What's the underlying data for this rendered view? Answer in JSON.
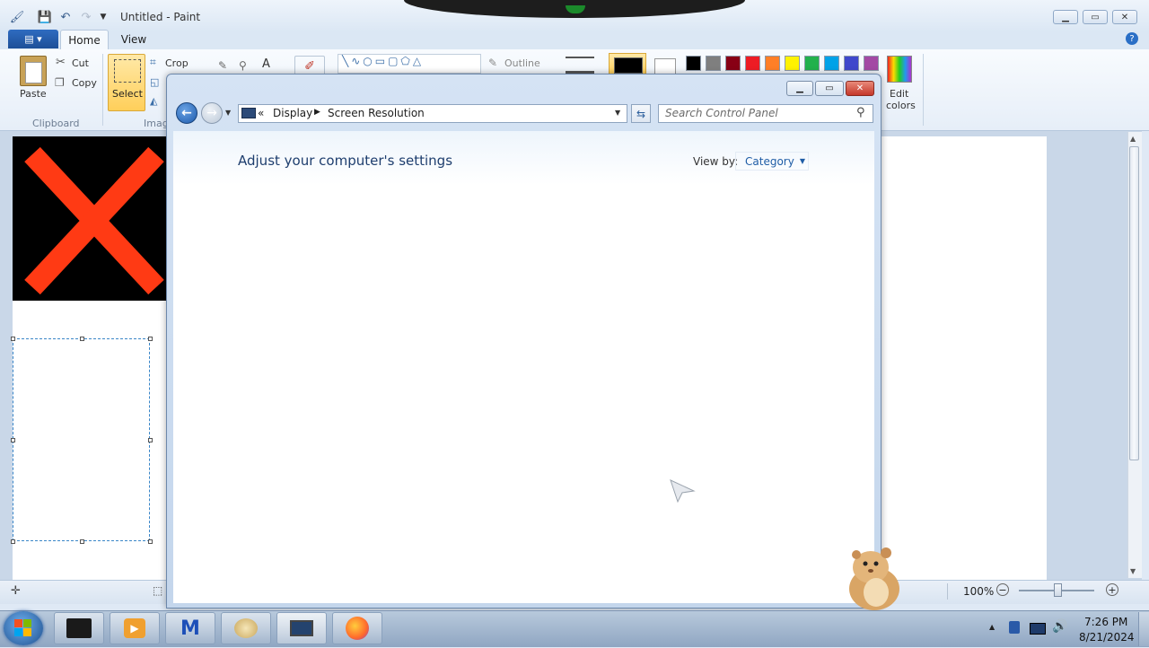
{
  "paint": {
    "title": "Untitled - Paint",
    "tabs": {
      "file": "▤ ▾",
      "home": "Home",
      "view": "View"
    },
    "clipboard": {
      "paste": "Paste",
      "cut": "Cut",
      "copy": "Copy",
      "group": "Clipboard"
    },
    "image": {
      "select": "Select",
      "crop": "Crop",
      "group": "Imag"
    },
    "shapes": {
      "outline": "Outline"
    },
    "edit_colors": [
      "Edit",
      "colors"
    ],
    "palette": [
      "#000000",
      "#7f7f7f",
      "#880015",
      "#ed1c24",
      "#ff7f27",
      "#fff200",
      "#22b14c",
      "#00a2e8",
      "#3f48cc",
      "#a349a4"
    ],
    "color1": "#000000",
    "color2": "#ffffff",
    "zoom": "100%"
  },
  "control_panel": {
    "breadcrumb": {
      "chevrons": "«",
      "display": "Display",
      "screen_resolution": "Screen Resolution"
    },
    "search_placeholder": "Search Control Panel",
    "heading": "Adjust your computer's settings",
    "view_by_label": "View by:",
    "view_by_value": "Category"
  },
  "taskbar": {
    "time": "7:26 PM",
    "date": "8/21/2024"
  }
}
